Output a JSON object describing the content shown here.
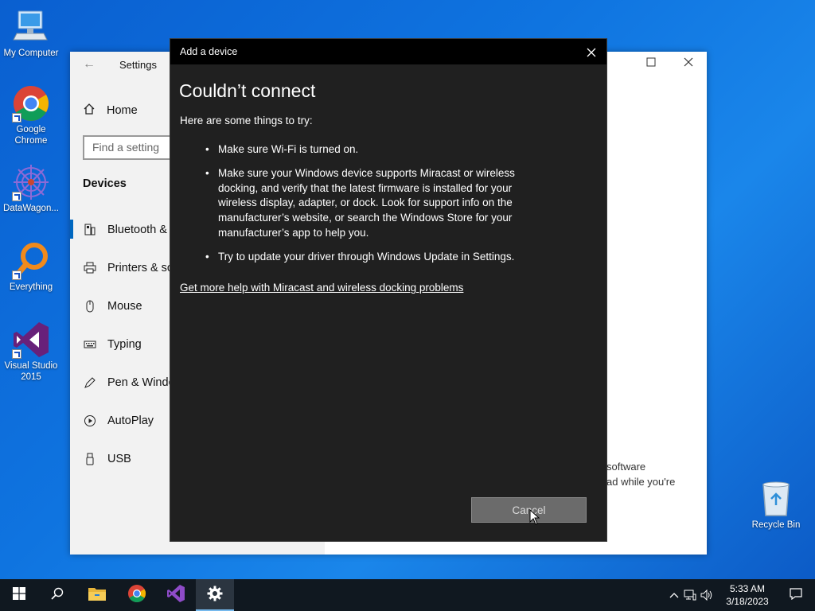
{
  "desktop": {
    "icons": [
      {
        "label": "My Computer",
        "icon": "computer-icon"
      },
      {
        "label": "Google Chrome",
        "icon": "chrome-icon"
      },
      {
        "label": "DataWagon...",
        "icon": "datawagon-icon"
      },
      {
        "label": "Everything",
        "icon": "search-magnifier-icon"
      },
      {
        "label": "Visual Studio 2015",
        "icon": "visual-studio-icon"
      },
      {
        "label": "Recycle Bin",
        "icon": "recycle-bin-icon"
      }
    ]
  },
  "settings": {
    "title": "Settings",
    "home_label": "Home",
    "search_placeholder": "Find a setting",
    "section": "Devices",
    "nav_items": [
      {
        "label": "Bluetooth & ",
        "icon": "bluetooth-device-icon"
      },
      {
        "label": "Printers & sc",
        "icon": "printer-icon"
      },
      {
        "label": "Mouse",
        "icon": "mouse-icon"
      },
      {
        "label": "Typing",
        "icon": "keyboard-icon"
      },
      {
        "label": "Pen & Windo",
        "icon": "pen-icon"
      },
      {
        "label": "AutoPlay",
        "icon": "autoplay-icon"
      },
      {
        "label": "USB",
        "icon": "usb-icon"
      }
    ],
    "background_text_1": "software",
    "background_text_2": "ad while you're"
  },
  "dialog": {
    "window_title": "Add a device",
    "heading": "Couldn’t connect",
    "intro": "Here are some things to try:",
    "tips": [
      "Make sure Wi-Fi is turned on.",
      "Make sure your Windows device supports Miracast or wireless docking, and verify that the latest firmware is installed for your wireless display, adapter, or dock. Look for support info on the manufacturer’s website, or search the Windows Store for your manufacturer’s app to help you.",
      "Try to update your driver through Windows Update in Settings."
    ],
    "help_link": "Get more help with Miracast and wireless docking problems",
    "cancel_label": "Cancel"
  },
  "taskbar": {
    "time": "5:33 AM",
    "date": "3/18/2023"
  },
  "colors": {
    "accent": "#0067c0",
    "dialog_bg": "#202020",
    "taskbar_bg": "#101820"
  }
}
